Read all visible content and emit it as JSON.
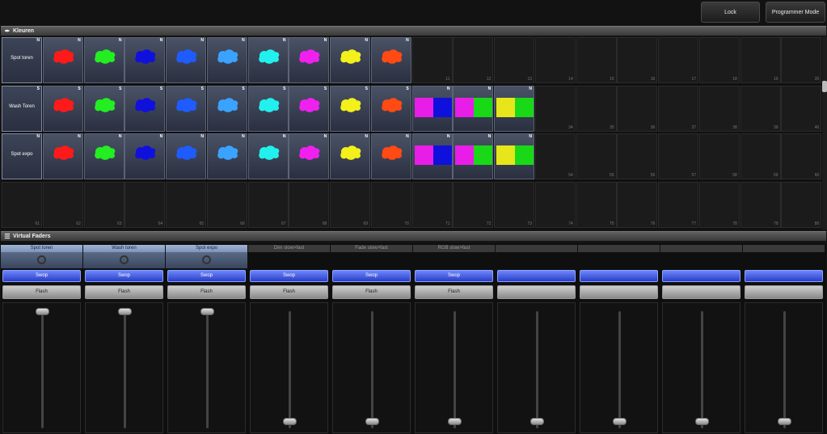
{
  "toolbar": {
    "lock_label": "Lock",
    "mode_label": "Programmer Mode"
  },
  "colors_section": {
    "title": "Kleuren",
    "rows": [
      {
        "label": "Spot toren",
        "corner": "N",
        "cells": [
          {
            "type": "splat",
            "color": "#ff1a1a",
            "corner": "N"
          },
          {
            "type": "splat",
            "color": "#22ee22",
            "corner": "N"
          },
          {
            "type": "splat",
            "color": "#1010dd",
            "corner": "N"
          },
          {
            "type": "splat",
            "color": "#1e5cff",
            "corner": "N"
          },
          {
            "type": "splat",
            "color": "#3aa2ff",
            "corner": "N"
          },
          {
            "type": "splat",
            "color": "#22f0ee",
            "corner": "N"
          },
          {
            "type": "splat",
            "color": "#f020f0",
            "corner": "N"
          },
          {
            "type": "splat",
            "color": "#f4f01a",
            "corner": "N"
          },
          {
            "type": "splat",
            "color": "#ff4a14",
            "corner": "N"
          },
          {
            "type": "empty",
            "num": "11"
          },
          {
            "type": "empty",
            "num": "12"
          },
          {
            "type": "empty",
            "num": "13"
          },
          {
            "type": "empty",
            "num": "14"
          },
          {
            "type": "empty",
            "num": "15"
          },
          {
            "type": "empty",
            "num": "16"
          },
          {
            "type": "empty",
            "num": "17"
          },
          {
            "type": "empty",
            "num": "18"
          },
          {
            "type": "empty",
            "num": "19"
          },
          {
            "type": "empty",
            "num": "20"
          }
        ]
      },
      {
        "label": "Wash Toren",
        "corner": "S",
        "cells": [
          {
            "type": "splat",
            "color": "#ff1a1a",
            "corner": "S"
          },
          {
            "type": "splat",
            "color": "#22ee22",
            "corner": "S"
          },
          {
            "type": "splat",
            "color": "#1010dd",
            "corner": "S"
          },
          {
            "type": "splat",
            "color": "#1e5cff",
            "corner": "S"
          },
          {
            "type": "splat",
            "color": "#3aa2ff",
            "corner": "S"
          },
          {
            "type": "splat",
            "color": "#22f0ee",
            "corner": "S"
          },
          {
            "type": "splat",
            "color": "#f020f0",
            "corner": "S"
          },
          {
            "type": "splat",
            "color": "#f4f01a",
            "corner": "S"
          },
          {
            "type": "splat",
            "color": "#ff4a14",
            "corner": "S"
          },
          {
            "type": "split",
            "colors": [
              "#e81ee8",
              "#1010dd"
            ],
            "corner": "N"
          },
          {
            "type": "split",
            "colors": [
              "#e81ee8",
              "#18d818"
            ],
            "corner": "N"
          },
          {
            "type": "split",
            "colors": [
              "#e6e61a",
              "#18d818"
            ],
            "corner": "N"
          },
          {
            "type": "empty",
            "num": "34"
          },
          {
            "type": "empty",
            "num": "35"
          },
          {
            "type": "empty",
            "num": "36"
          },
          {
            "type": "empty",
            "num": "37"
          },
          {
            "type": "empty",
            "num": "38"
          },
          {
            "type": "empty",
            "num": "39"
          },
          {
            "type": "empty",
            "num": "40"
          }
        ]
      },
      {
        "label": "Spot expo",
        "corner": "N",
        "cells": [
          {
            "type": "splat",
            "color": "#ff1a1a",
            "corner": "N"
          },
          {
            "type": "splat",
            "color": "#22ee22",
            "corner": "N"
          },
          {
            "type": "splat",
            "color": "#1010dd",
            "corner": "N"
          },
          {
            "type": "splat",
            "color": "#1e5cff",
            "corner": "N"
          },
          {
            "type": "splat",
            "color": "#3aa2ff",
            "corner": "N"
          },
          {
            "type": "splat",
            "color": "#22f0ee",
            "corner": "N"
          },
          {
            "type": "splat",
            "color": "#f020f0",
            "corner": "N"
          },
          {
            "type": "splat",
            "color": "#f4f01a",
            "corner": "N"
          },
          {
            "type": "splat",
            "color": "#ff4a14",
            "corner": "N"
          },
          {
            "type": "split",
            "colors": [
              "#e81ee8",
              "#1010dd"
            ],
            "corner": "N"
          },
          {
            "type": "split",
            "colors": [
              "#e81ee8",
              "#18d818"
            ],
            "corner": "N"
          },
          {
            "type": "split",
            "colors": [
              "#e6e61a",
              "#18d818"
            ],
            "corner": "N"
          },
          {
            "type": "empty",
            "num": "54"
          },
          {
            "type": "empty",
            "num": "55"
          },
          {
            "type": "empty",
            "num": "56"
          },
          {
            "type": "empty",
            "num": "57"
          },
          {
            "type": "empty",
            "num": "58"
          },
          {
            "type": "empty",
            "num": "59"
          },
          {
            "type": "empty",
            "num": "60"
          }
        ]
      },
      {
        "label": "",
        "corner": "",
        "cells": [
          {
            "type": "empty",
            "num": "61"
          },
          {
            "type": "empty",
            "num": "62"
          },
          {
            "type": "empty",
            "num": "63"
          },
          {
            "type": "empty",
            "num": "64"
          },
          {
            "type": "empty",
            "num": "65"
          },
          {
            "type": "empty",
            "num": "66"
          },
          {
            "type": "empty",
            "num": "67"
          },
          {
            "type": "empty",
            "num": "68"
          },
          {
            "type": "empty",
            "num": "69"
          },
          {
            "type": "empty",
            "num": "70"
          },
          {
            "type": "empty",
            "num": "71"
          },
          {
            "type": "empty",
            "num": "72"
          },
          {
            "type": "empty",
            "num": "73"
          },
          {
            "type": "empty",
            "num": "74"
          },
          {
            "type": "empty",
            "num": "75"
          },
          {
            "type": "empty",
            "num": "76"
          },
          {
            "type": "empty",
            "num": "77"
          },
          {
            "type": "empty",
            "num": "78"
          },
          {
            "type": "empty",
            "num": "79"
          },
          {
            "type": "empty",
            "num": "80"
          }
        ]
      }
    ],
    "first_row_label_corner": "N"
  },
  "faders_section": {
    "title": "Virtual Faders",
    "faders": [
      {
        "name": "Spot toren",
        "active": true,
        "swop": "Swop",
        "flash": "Flash",
        "level": 1.0
      },
      {
        "name": "Wash toren",
        "active": true,
        "swop": "Swop",
        "flash": "Flash",
        "level": 1.0
      },
      {
        "name": "Spot expo",
        "active": true,
        "swop": "Swop",
        "flash": "Flash",
        "level": 1.0
      },
      {
        "name": "Dim slow>fast",
        "active": false,
        "swop": "Swop",
        "flash": "Flash",
        "level": 0.0
      },
      {
        "name": "Fade slow>fast",
        "active": false,
        "swop": "Swop",
        "flash": "Flash",
        "level": 0.0
      },
      {
        "name": "RGB slow>fast",
        "active": false,
        "swop": "Swop",
        "flash": "Flash",
        "level": 0.0
      },
      {
        "name": "",
        "active": false,
        "swop": "",
        "flash": "",
        "level": 0.0
      },
      {
        "name": "",
        "active": false,
        "swop": "",
        "flash": "",
        "level": 0.0
      },
      {
        "name": "",
        "active": false,
        "swop": "",
        "flash": "",
        "level": 0.0
      },
      {
        "name": "",
        "active": false,
        "swop": "",
        "flash": "",
        "level": 0.0
      }
    ]
  }
}
